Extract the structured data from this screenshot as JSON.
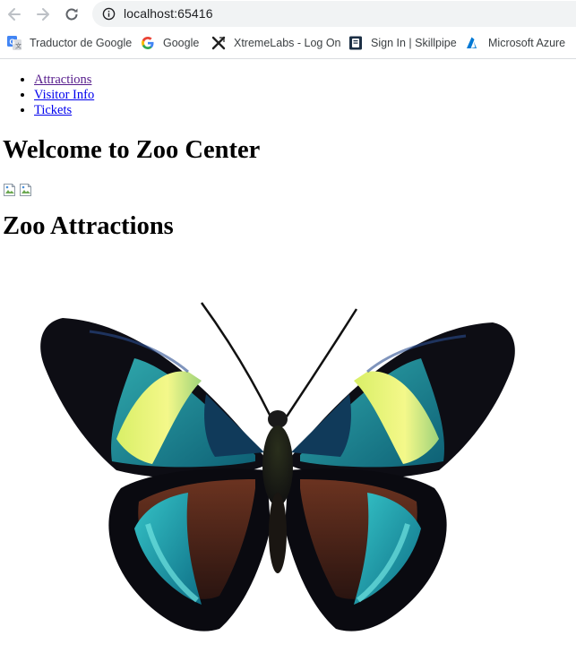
{
  "browser": {
    "url": "localhost:65416",
    "bookmarks": [
      {
        "label": "Traductor de Google",
        "icon": "google-translate-icon"
      },
      {
        "label": "Google",
        "icon": "google-icon"
      },
      {
        "label": "XtremeLabs - Log On",
        "icon": "xtremelabs-icon"
      },
      {
        "label": "Sign In | Skillpipe",
        "icon": "skillpipe-icon"
      },
      {
        "label": "Microsoft Azure",
        "icon": "azure-icon"
      }
    ]
  },
  "nav": {
    "items": [
      {
        "label": "Attractions"
      },
      {
        "label": "Visitor Info"
      },
      {
        "label": "Tickets"
      }
    ]
  },
  "main": {
    "title": "Welcome to Zoo Center",
    "section_title": "Zoo Attractions",
    "image_subject": "butterfly"
  },
  "colors": {
    "link": "#0000ee",
    "visited_link": "#551a8b",
    "omnibox_bg": "#f1f3f4"
  }
}
